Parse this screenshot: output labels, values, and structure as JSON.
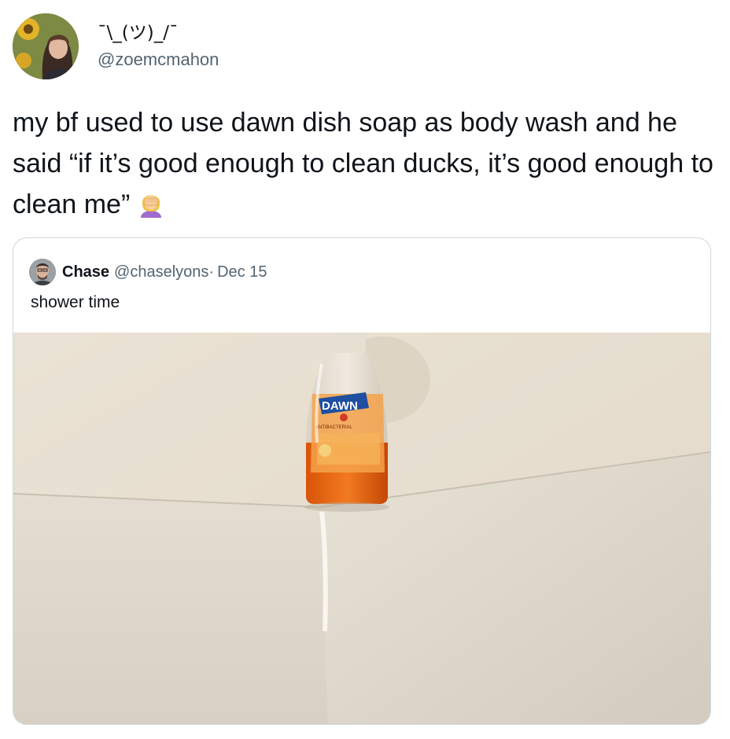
{
  "tweet": {
    "display_name": "¯\\_(ツ)_/¯",
    "handle": "@zoemcmahon",
    "text": "my bf used to use dawn dish soap as body wash and he said “if it’s good enough to clean ducks, it’s good enough to clean me”",
    "emoji_icon": "woman-facepalming-icon"
  },
  "quote": {
    "name": "Chase",
    "handle": "@chaselyons",
    "separator": "·",
    "date": "Dec 15",
    "text": "shower time",
    "media": {
      "description_icon": "dish-soap-bottle-photo",
      "label_brand": "DAWN",
      "label_sub": "ANTIBACTERIAL",
      "colors": {
        "wall": "#e9e2d6",
        "tub": "#ddd6ca",
        "soap": "#e8620f"
      }
    }
  }
}
